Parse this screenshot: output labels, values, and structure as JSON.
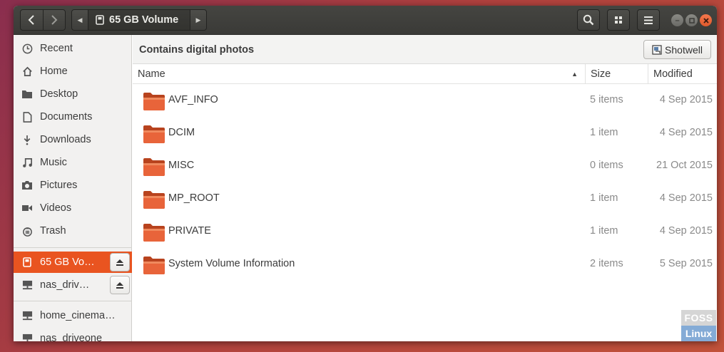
{
  "headerbar": {
    "location": "65 GB Volume",
    "icons": [
      "back-icon",
      "forward-icon",
      "search-icon",
      "view-grid-icon",
      "menu-icon"
    ],
    "window_controls": [
      "minimize",
      "maximize",
      "close"
    ]
  },
  "sidebar": {
    "places": [
      {
        "label": "Recent",
        "icon": "clock-icon"
      },
      {
        "label": "Home",
        "icon": "home-icon"
      },
      {
        "label": "Desktop",
        "icon": "folder-icon"
      },
      {
        "label": "Documents",
        "icon": "document-icon"
      },
      {
        "label": "Downloads",
        "icon": "download-icon"
      },
      {
        "label": "Music",
        "icon": "music-icon"
      },
      {
        "label": "Pictures",
        "icon": "camera-icon"
      },
      {
        "label": "Videos",
        "icon": "video-icon"
      },
      {
        "label": "Trash",
        "icon": "trash-icon"
      }
    ],
    "devices": [
      {
        "label": "65 GB Vo…",
        "icon": "drive-icon",
        "active": true
      },
      {
        "label": "nas_driv…",
        "icon": "network-drive-icon",
        "active": false
      }
    ],
    "network": [
      {
        "label": "home_cinema…",
        "icon": "network-drive-icon"
      },
      {
        "label": "nas_driveone",
        "icon": "network-drive-icon"
      }
    ]
  },
  "infobar": {
    "message": "Contains digital photos",
    "button_label": "Shotwell"
  },
  "columns": {
    "name": "Name",
    "size": "Size",
    "modified": "Modified"
  },
  "files": [
    {
      "name": "AVF_INFO",
      "size": "5 items",
      "modified": "4 Sep 2015"
    },
    {
      "name": "DCIM",
      "size": "1 item",
      "modified": "4 Sep 2015"
    },
    {
      "name": "MISC",
      "size": "0 items",
      "modified": "21 Oct 2015"
    },
    {
      "name": "MP_ROOT",
      "size": "1 item",
      "modified": "4 Sep 2015"
    },
    {
      "name": "PRIVATE",
      "size": "1 item",
      "modified": "4 Sep 2015"
    },
    {
      "name": "System Volume Information",
      "size": "2 items",
      "modified": "5 Sep 2015"
    }
  ],
  "watermark": {
    "line1": "FOSS",
    "line2": "Linux"
  },
  "colors": {
    "accent": "#e95420",
    "folder": "#e8643a"
  }
}
